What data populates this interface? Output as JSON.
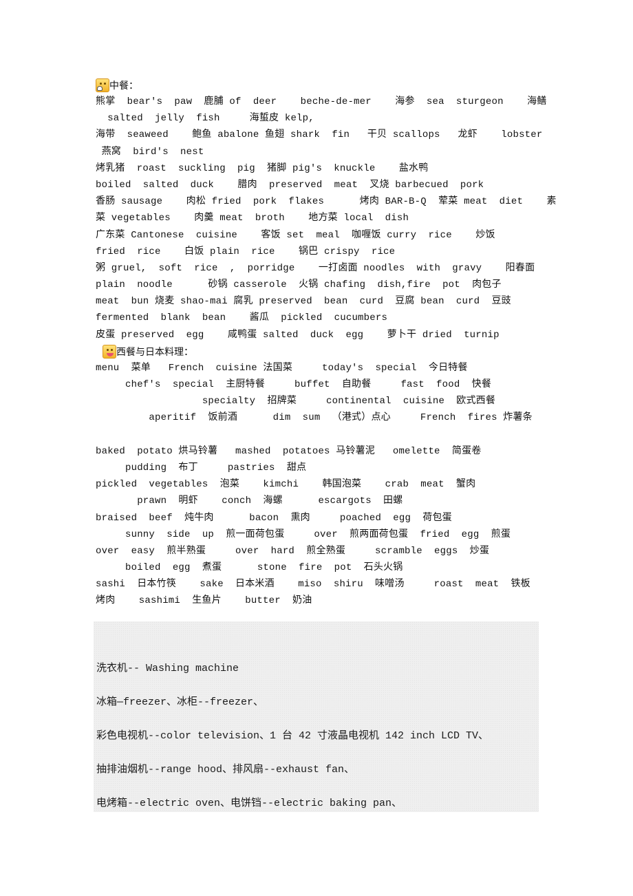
{
  "section_chinese": {
    "icon": "rice-ball-emoticon-icon",
    "heading": "中餐：",
    "lines": [
      "熊掌  bear's  paw  鹿脯 of  deer    beche-de-mer    海参  sea  sturgeon    海鳝",
      "  salted  jelly  fish     海蜇皮 kelp,",
      "海带  seaweed    鲍鱼 abalone 鱼翅 shark  fin   干贝 scallops   龙虾    lobster",
      " 燕窝  bird's  nest",
      "烤乳猪  roast  suckling  pig  猪脚 pig's  knuckle    盐水鸭",
      "boiled  salted  duck    腊肉  preserved  meat  叉烧 barbecued  pork",
      "香肠 sausage    肉松 fried  pork  flakes      烤肉 BAR-B-Q  荤菜 meat  diet    素",
      "菜 vegetables    肉羹 meat  broth    地方菜 local  dish",
      "广东菜 Cantonese  cuisine    客饭 set  meal  咖喱饭 curry  rice    炒饭",
      "fried  rice    白饭 plain  rice    锅巴 crispy  rice",
      "粥 gruel,  soft  rice  ,  porridge    一打卤面 noodles  with  gravy    阳春面",
      "plain  noodle      砂锅 casserole  火锅 chafing  dish,fire  pot  肉包子",
      "meat  bun 烧麦 shao-mai 腐乳 preserved  bean  curd  豆腐 bean  curd  豆豉",
      "fermented  blank  bean    酱瓜  pickled  cucumbers",
      "皮蛋 preserved  egg    咸鸭蛋 salted  duck  egg    萝卜干 dried  turnip"
    ]
  },
  "section_western": {
    "icon": "grinning-face-emoticon-icon",
    "heading": "西餐与日本料理：",
    "lines": [
      "menu  菜单   French  cuisine 法国菜     today's  special  今日特餐",
      "     chef's  special  主厨特餐     buffet  自助餐     fast  food  快餐",
      "                  specialty  招牌菜     continental  cuisine  欧式西餐",
      "         aperitif  饭前酒      dim  sum  （港式）点心     French  fires 炸薯条",
      "",
      "baked  potato 烘马铃薯   mashed  potatoes 马铃薯泥   omelette  简蛋卷",
      "     pudding  布丁     pastries  甜点",
      "pickled  vegetables  泡菜    kimchi    韩国泡菜    crab  meat  蟹肉",
      "       prawn  明虾    conch  海螺      escargots  田螺",
      "braised  beef  炖牛肉      bacon  熏肉     poached  egg  荷包蛋",
      "     sunny  side  up  煎一面荷包蛋     over  煎两面荷包蛋  fried  egg  煎蛋",
      "over  easy  煎半熟蛋     over  hard  煎全熟蛋     scramble  eggs  炒蛋",
      "     boiled  egg  煮蛋      stone  fire  pot  石头火锅",
      "sashi  日本竹筷    sake  日本米酒    miso  shiru  味噌汤     roast  meat  铁板",
      "烤肉    sashimi  生鱼片    butter  奶油"
    ]
  },
  "appliances": {
    "lines": [
      "洗衣机-- Washing machine",
      "冰箱—freezer、冰柜--freezer、",
      "彩色电视机--color television、1 台 42 寸液晶电视机 142 inch LCD TV、",
      "抽排油烟机--range hood、排风扇--exhaust fan、",
      "电烤箱--electric oven、电饼铛--electric baking pan、"
    ]
  }
}
